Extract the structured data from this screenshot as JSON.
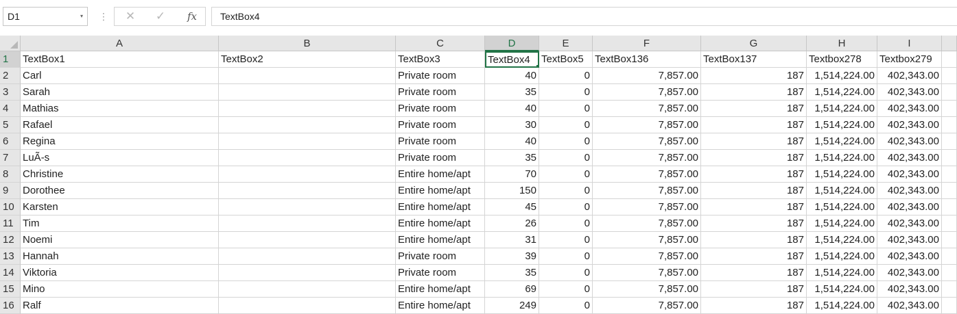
{
  "formula_bar": {
    "name_box": "D1",
    "dropdown_icon": "▾",
    "cancel_icon": "✕",
    "enter_icon": "✓",
    "function_icon": "fx",
    "formula": "TextBox4"
  },
  "columns": [
    "A",
    "B",
    "C",
    "D",
    "E",
    "F",
    "G",
    "H",
    "I"
  ],
  "selected_column": "D",
  "rows": [
    {
      "n": "1",
      "cells": [
        "TextBox1",
        "TextBox2",
        "TextBox3",
        "TextBox4",
        "TextBox5",
        "TextBox136",
        "TextBox137",
        "Textbox278",
        "Textbox279"
      ]
    },
    {
      "n": "2",
      "cells": [
        "Carl",
        "",
        "Private room",
        "40",
        "0",
        "7,857.00",
        "187",
        "1,514,224.00",
        "402,343.00"
      ]
    },
    {
      "n": "3",
      "cells": [
        "Sarah",
        "",
        "Private room",
        "35",
        "0",
        "7,857.00",
        "187",
        "1,514,224.00",
        "402,343.00"
      ]
    },
    {
      "n": "4",
      "cells": [
        "Mathias",
        "",
        "Private room",
        "40",
        "0",
        "7,857.00",
        "187",
        "1,514,224.00",
        "402,343.00"
      ]
    },
    {
      "n": "5",
      "cells": [
        "Rafael",
        "",
        "Private room",
        "30",
        "0",
        "7,857.00",
        "187",
        "1,514,224.00",
        "402,343.00"
      ]
    },
    {
      "n": "6",
      "cells": [
        "Regina",
        "",
        "Private room",
        "40",
        "0",
        "7,857.00",
        "187",
        "1,514,224.00",
        "402,343.00"
      ]
    },
    {
      "n": "7",
      "cells": [
        "LuÃ-s",
        "",
        "Private room",
        "35",
        "0",
        "7,857.00",
        "187",
        "1,514,224.00",
        "402,343.00"
      ]
    },
    {
      "n": "8",
      "cells": [
        "Christine",
        "",
        "Entire home/apt",
        "70",
        "0",
        "7,857.00",
        "187",
        "1,514,224.00",
        "402,343.00"
      ]
    },
    {
      "n": "9",
      "cells": [
        "Dorothee",
        "",
        "Entire home/apt",
        "150",
        "0",
        "7,857.00",
        "187",
        "1,514,224.00",
        "402,343.00"
      ]
    },
    {
      "n": "10",
      "cells": [
        "Karsten",
        "",
        "Entire home/apt",
        "45",
        "0",
        "7,857.00",
        "187",
        "1,514,224.00",
        "402,343.00"
      ]
    },
    {
      "n": "11",
      "cells": [
        "Tim",
        "",
        "Entire home/apt",
        "26",
        "0",
        "7,857.00",
        "187",
        "1,514,224.00",
        "402,343.00"
      ]
    },
    {
      "n": "12",
      "cells": [
        "Noemi",
        "",
        "Entire home/apt",
        "31",
        "0",
        "7,857.00",
        "187",
        "1,514,224.00",
        "402,343.00"
      ]
    },
    {
      "n": "13",
      "cells": [
        "Hannah",
        "",
        "Private room",
        "39",
        "0",
        "7,857.00",
        "187",
        "1,514,224.00",
        "402,343.00"
      ]
    },
    {
      "n": "14",
      "cells": [
        "Viktoria",
        "",
        "Private room",
        "35",
        "0",
        "7,857.00",
        "187",
        "1,514,224.00",
        "402,343.00"
      ]
    },
    {
      "n": "15",
      "cells": [
        "Mino",
        "",
        "Entire home/apt",
        "69",
        "0",
        "7,857.00",
        "187",
        "1,514,224.00",
        "402,343.00"
      ]
    },
    {
      "n": "16",
      "cells": [
        "Ralf",
        "",
        "Entire home/apt",
        "249",
        "0",
        "7,857.00",
        "187",
        "1,514,224.00",
        "402,343.00"
      ]
    }
  ]
}
